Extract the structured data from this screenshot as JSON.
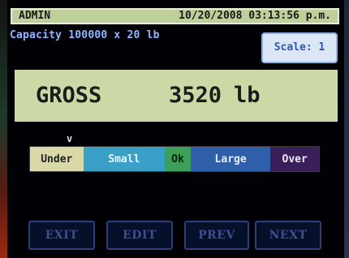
{
  "status_bar": {
    "user": "ADMIN",
    "datetime": "10/20/2008 03:13:56 p.m."
  },
  "capacity": "Capacity 100000 x 20 lb",
  "scale_button": "Scale: 1",
  "weight": {
    "mode": "GROSS",
    "value": "3520",
    "unit": "lb"
  },
  "indicator": "v",
  "zones": {
    "under": "Under",
    "small": "Small",
    "ok": "Ok",
    "large": "Large",
    "over": "Over"
  },
  "buttons": {
    "exit": "EXIT",
    "edit": "EDIT",
    "prev": "PREV",
    "next": "NEXT"
  },
  "colors": {
    "lcd_green": "#cbd9a6",
    "status_green": "#bfcf9a",
    "capacity_text": "#8fb6ff",
    "under": "#d8d8a8",
    "small": "#3aa0c8",
    "ok": "#3aa05a",
    "large": "#2f5fa8",
    "over": "#3a1e5a"
  }
}
